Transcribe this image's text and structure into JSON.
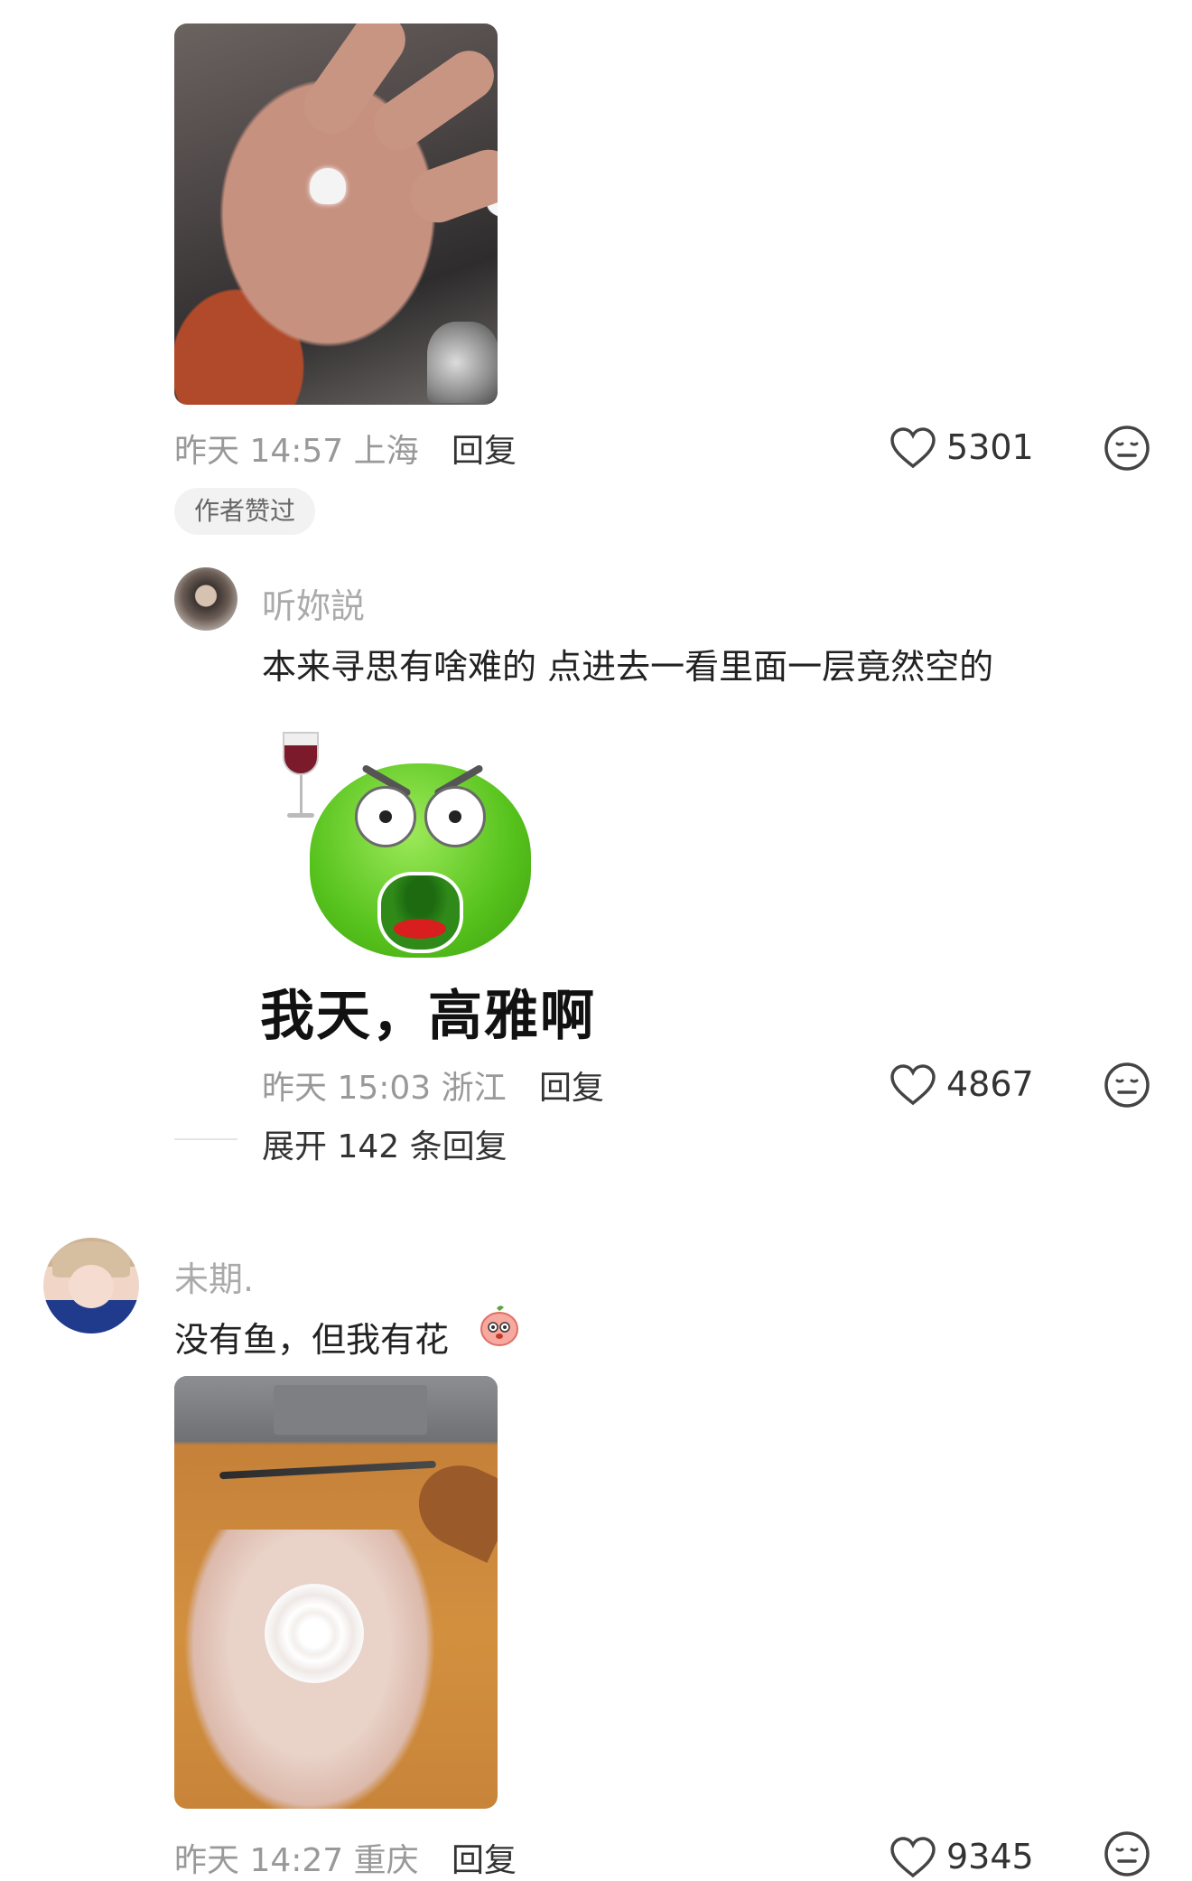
{
  "comments": [
    {
      "time": "昨天 14:57 上海",
      "reply": "回复",
      "likes": "5301",
      "badge": "作者赞过"
    },
    {
      "username": "听妳説",
      "text": "本来寻思有啥难的 点进去一看里面一层竟然空的",
      "sticker_caption": "我天，高雅啊",
      "time": "昨天 15:03 浙江",
      "reply": "回复",
      "likes": "4867",
      "expand": "展开 142 条回复"
    },
    {
      "username": "未期.",
      "text": "没有鱼，但我有花",
      "time": "昨天 14:27 重庆",
      "reply": "回复",
      "likes": "9345"
    }
  ],
  "icons": {
    "like": "heart-outline-icon",
    "dislike": "neutral-face-icon",
    "emoji": "peach-emoji-icon"
  }
}
